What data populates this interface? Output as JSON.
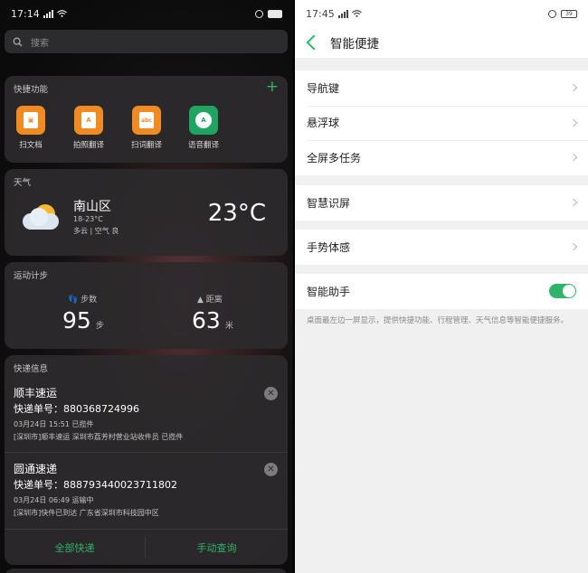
{
  "left": {
    "status": {
      "time": "17:14",
      "battery": ""
    },
    "search": {
      "placeholder": "搜索"
    },
    "quick": {
      "title": "快捷功能",
      "items": [
        {
          "label": "扫文档",
          "icon": "scan-doc-icon",
          "glyph": "▣"
        },
        {
          "label": "拍照翻译",
          "icon": "photo-translate-icon",
          "glyph": "A"
        },
        {
          "label": "扫词翻译",
          "icon": "scan-word-icon",
          "glyph": "abc"
        },
        {
          "label": "语音翻译",
          "icon": "voice-translate-icon",
          "glyph": "A"
        }
      ]
    },
    "weather": {
      "title": "天气",
      "location": "南山区",
      "range": "18-23°C",
      "desc": "多云 | 空气 良",
      "temp": "23°C"
    },
    "steps": {
      "title": "运动计步",
      "steps_label": "步数",
      "steps_value": "95",
      "steps_unit": "步",
      "distance_label": "距离",
      "distance_value": "63",
      "distance_unit": "米"
    },
    "express": {
      "title": "快递信息",
      "items": [
        {
          "company": "顺丰速运",
          "number": "快递单号：880368724996",
          "time": "03月24日 15:51  已揽件",
          "detail": "[深圳市]顺丰速运 深圳市荔芳村营业站收件员 已揽件"
        },
        {
          "company": "圆通速递",
          "number": "快递单号：888793440023711802",
          "time": "03月24日 06:49  运输中",
          "detail": "[深圳市]快件已到达 广东省深圳市科技园中区"
        }
      ],
      "all_btn": "全部快递",
      "manual_btn": "手动查询"
    }
  },
  "right": {
    "status": {
      "time": "17:45",
      "battery": "39"
    },
    "title": "智能便捷",
    "groups": [
      [
        "导航键",
        "悬浮球",
        "全屏多任务"
      ],
      [
        "智慧识屏"
      ],
      [
        "手势体感"
      ]
    ],
    "assistant": {
      "label": "智能助手",
      "enabled": true
    },
    "note": "桌面最左边一屏显示，提供快捷功能、行程管理、天气信息等智能便捷服务。"
  },
  "colors": {
    "accent": "#2fb46a",
    "orange": "#f08b24"
  }
}
